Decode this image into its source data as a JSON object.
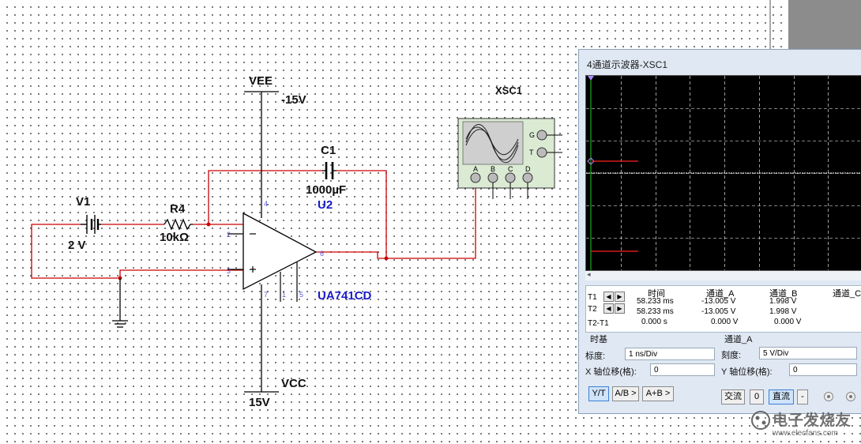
{
  "schematic": {
    "vee_label": "VEE",
    "vee_value": "-15V",
    "vcc_label": "VCC",
    "vcc_value": "15V",
    "capacitor_label": "C1",
    "capacitor_value": "1000µF",
    "opamp_ref": "U2",
    "opamp_model": "UA741CD",
    "source_label": "V1",
    "source_value": "2 V",
    "resistor_label": "R4",
    "resistor_value": "10kΩ",
    "scope_ref": "XSC1",
    "pins": {
      "p4": "4",
      "p2": "2",
      "p3": "3",
      "p6": "6",
      "p7": "7",
      "p1": "1",
      "p5": "5"
    },
    "scope_terminals": {
      "g": "G",
      "t": "T",
      "a": "A",
      "b": "B",
      "c": "C",
      "d": "D"
    },
    "wire_color": "#cc0000"
  },
  "oscilloscope": {
    "title": "4通道示波器-XSC1",
    "scroll_arrow": "◂",
    "trace_color": "#ff2020",
    "grid_color": "#ffffff",
    "cursor_color": "#22cc22",
    "measurements": {
      "headers": [
        "时间",
        "通道_A",
        "通道_B",
        "通道_C"
      ],
      "rows": [
        {
          "label": "T1",
          "time": "58.233 ms",
          "a": "-13.005 V",
          "b": "1.998 V"
        },
        {
          "label": "T2",
          "time": "58.233 ms",
          "a": "-13.005 V",
          "b": "1.998 V"
        },
        {
          "label": "T2-T1",
          "time": "0.000 s",
          "a": "0.000 V",
          "b": "0.000 V"
        }
      ]
    },
    "timebase": {
      "section_label": "时基",
      "scale_label": "标度:",
      "scale_value": "1 ns/Div",
      "xpos_label": "X 轴位移(格):",
      "xpos_value": "0",
      "mode_buttons": [
        "Y/T",
        "A/B >",
        "A+B >"
      ],
      "active_mode": "Y/T"
    },
    "channel": {
      "section_label": "通道_A",
      "scale_label": "刻度:",
      "scale_value": "5  V/Div",
      "ypos_label": "Y 轴位移(格):",
      "ypos_value": "0",
      "coupling_buttons": [
        "交流",
        "0",
        "直流",
        "-"
      ],
      "active_coupling": "直流"
    }
  },
  "watermark": {
    "text": "电子发烧友",
    "url": "www.elecfans.com"
  }
}
